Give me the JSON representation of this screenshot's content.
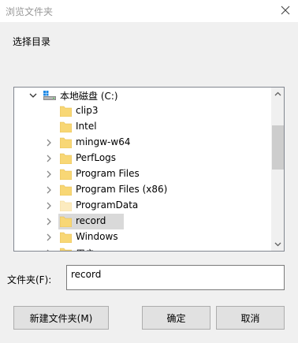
{
  "window": {
    "title": "浏览文件夹"
  },
  "instruction": "选择目录",
  "tree": {
    "items": [
      {
        "label": "本地磁盘 (C:)",
        "icon": "drive-icon",
        "expanded": true
      },
      {
        "label": "clip3",
        "icon": "folder-icon",
        "has_children": false
      },
      {
        "label": "Intel",
        "icon": "folder-icon",
        "has_children": false
      },
      {
        "label": "mingw-w64",
        "icon": "folder-icon",
        "has_children": true
      },
      {
        "label": "PerfLogs",
        "icon": "folder-icon",
        "has_children": true
      },
      {
        "label": "Program Files",
        "icon": "folder-icon",
        "has_children": true
      },
      {
        "label": "Program Files (x86)",
        "icon": "folder-icon",
        "has_children": true
      },
      {
        "label": "ProgramData",
        "icon": "folder-icon",
        "has_children": true,
        "hidden": true
      },
      {
        "label": "record",
        "icon": "folder-icon",
        "has_children": true,
        "selected": true
      },
      {
        "label": "Windows",
        "icon": "folder-icon",
        "has_children": true
      },
      {
        "label": "用户",
        "icon": "folder-icon",
        "has_children": true,
        "partially_visible": true
      }
    ]
  },
  "folder_field": {
    "label": "文件夹(F):",
    "value": "record"
  },
  "buttons": {
    "new_folder": "新建文件夹(M)",
    "ok": "确定",
    "cancel": "取消"
  },
  "colors": {
    "folder": "#f8d775",
    "folder_hidden": "#fcebbf",
    "selection": "#d9d9d9",
    "border": "#828790"
  }
}
